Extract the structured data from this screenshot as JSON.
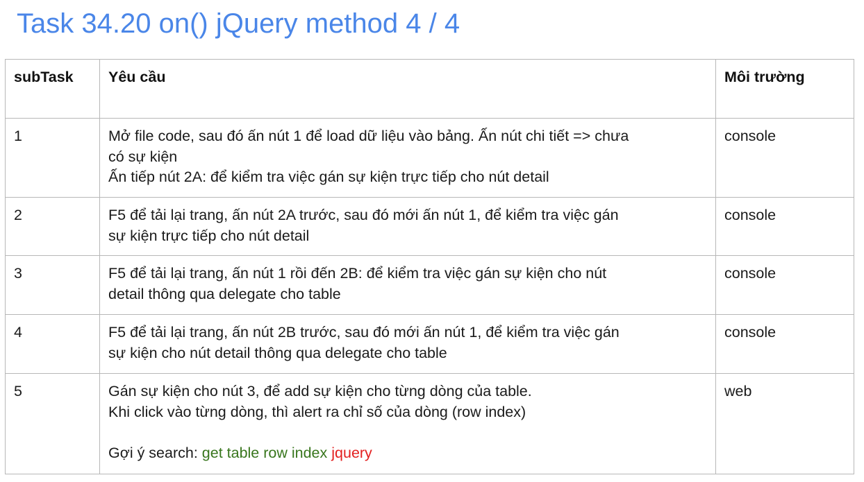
{
  "title": "Task 34.20 on() jQuery method 4 / 4",
  "table": {
    "headers": [
      "subTask",
      "Yêu cầu",
      "Môi trường"
    ],
    "rows": [
      {
        "subtask": "1",
        "requirement_lines": [
          "Mở file code, sau đó ấn nút 1 để load dữ liệu vào bảng. Ấn nút chi tiết => chưa",
          "có sự kiện",
          "Ấn tiếp nút 2A: để kiểm tra việc gán sự kiện trực tiếp cho nút detail"
        ],
        "environment": "console"
      },
      {
        "subtask": "2",
        "requirement_lines": [
          "F5 để tải lại trang, ấn nút 2A trước, sau đó mới ấn nút 1, để kiểm tra việc gán",
          "sự kiện trực tiếp cho nút detail"
        ],
        "environment": "console"
      },
      {
        "subtask": "3",
        "requirement_lines": [
          "F5 để tải lại trang, ấn nút 1 rồi đến 2B: để kiểm tra việc gán sự kiện cho nút",
          "detail thông qua delegate cho table"
        ],
        "environment": "console"
      },
      {
        "subtask": "4",
        "requirement_lines": [
          "F5 để tải lại trang, ấn nút 2B trước, sau đó mới ấn nút 1, để kiểm tra việc gán",
          "sự kiện cho nút detail thông qua delegate cho table"
        ],
        "environment": "console"
      },
      {
        "subtask": "5",
        "requirement_lines": [
          "Gán sự kiện cho nút 3, để add sự kiện cho từng dòng của table.",
          "Khi click vào từng dòng, thì alert ra chỉ số của dòng (row index)"
        ],
        "hint_prefix": "Gợi ý search: ",
        "hint_green": "get table row index",
        "hint_red": "jquery",
        "environment": "web"
      }
    ]
  },
  "colors": {
    "title": "#4a86e8",
    "hint_green": "#38761d",
    "hint_red": "#e32020",
    "border": "#b7b7b7"
  }
}
